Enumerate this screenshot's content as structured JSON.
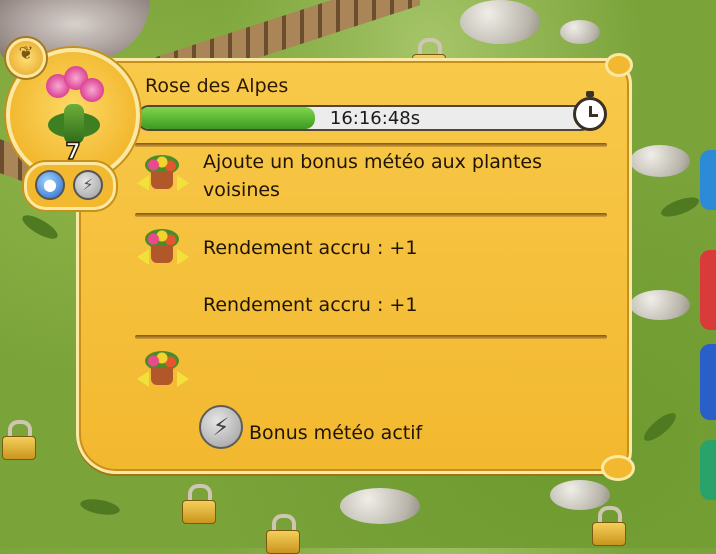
{
  "plant": {
    "name": "Rose des Alpes",
    "level": "7",
    "timer_text": "16:16:48s",
    "timer_progress": 0.39
  },
  "effects": [
    {
      "text_line1": "Ajoute un bonus météo aux plantes",
      "text_line2": "voisines"
    },
    {
      "text_line1": "Rendement accru : +1",
      "text_line2": "Rendement accru : +1"
    },
    {
      "text_line1": "",
      "text_line2": ""
    }
  ],
  "weather_bonus": {
    "label": "Bonus météo actif"
  },
  "icons": {
    "seed": "seed-icon",
    "water": "water-drop-icon",
    "bolt": "lightning-icon",
    "stopwatch": "stopwatch-icon",
    "neighbor": "neighbor-flowers-icon",
    "lock": "lock-icon"
  },
  "colors": {
    "panel": "#f2b82f",
    "panel_border": "#fbe9a3",
    "progress": "#4caf2a"
  }
}
